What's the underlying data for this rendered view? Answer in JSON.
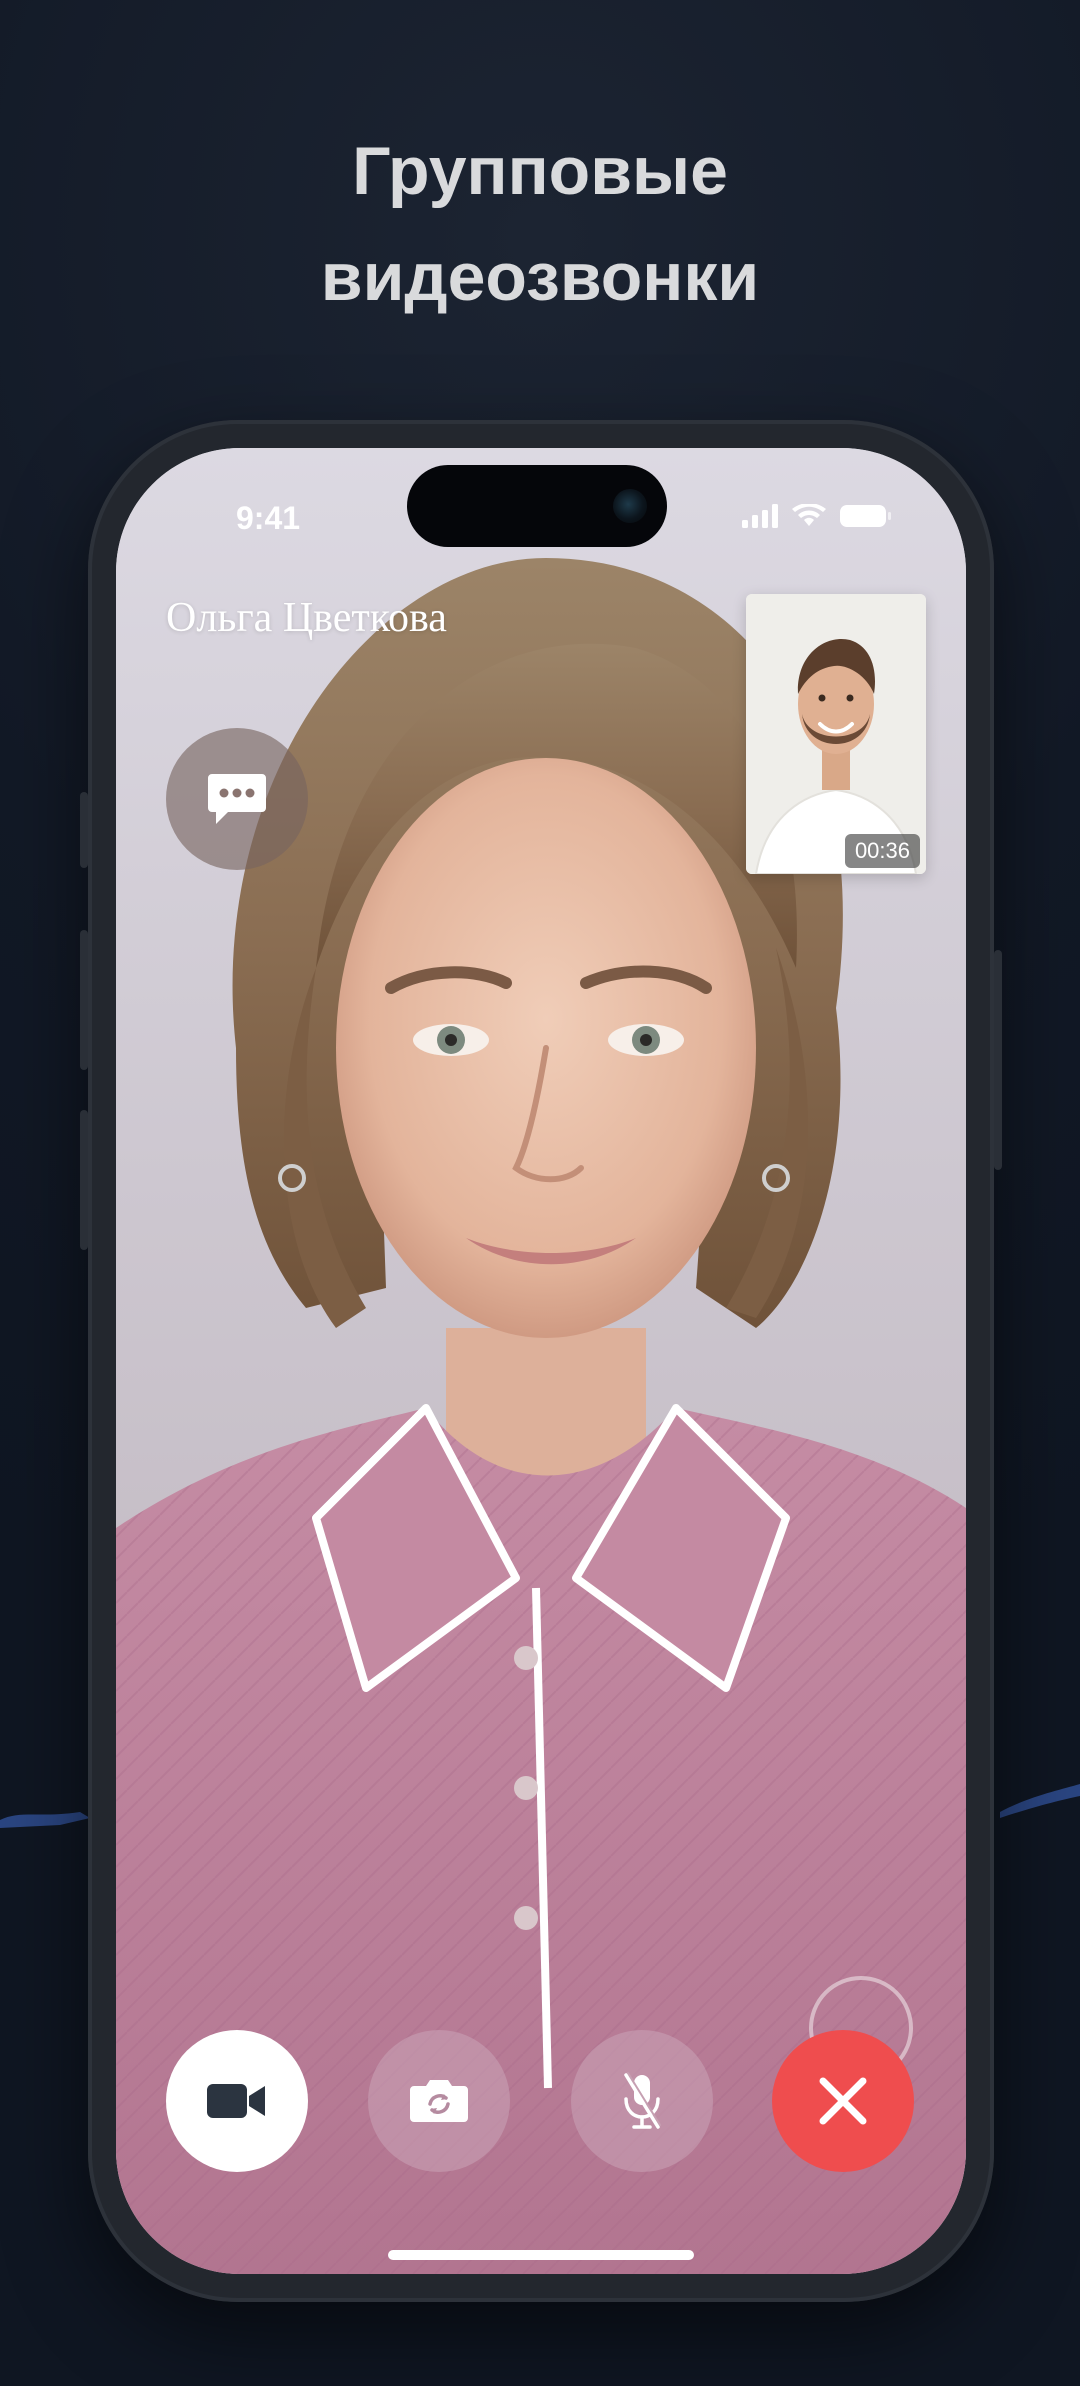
{
  "promo": {
    "headline_line1": "Групповые",
    "headline_line2": "видеозвонки"
  },
  "status_bar": {
    "time": "9:41",
    "icons": [
      "signal-icon",
      "wifi-icon",
      "battery-icon"
    ]
  },
  "call": {
    "caller_name": "Ольга Цветкова",
    "timer": "00:36",
    "chat_icon": "chat-bubble-icon",
    "controls": [
      {
        "name": "video-toggle-button",
        "icon": "video-camera-icon"
      },
      {
        "name": "flip-camera-button",
        "icon": "camera-flip-icon"
      },
      {
        "name": "mute-button",
        "icon": "microphone-off-icon"
      },
      {
        "name": "end-call-button",
        "icon": "close-icon"
      }
    ]
  },
  "colors": {
    "background": "#131a26",
    "headline": "#d9dadc",
    "end_call": "#ef4d4e",
    "control_tint": "#c8a0b4",
    "accent_wave": "#2e4a8c"
  }
}
